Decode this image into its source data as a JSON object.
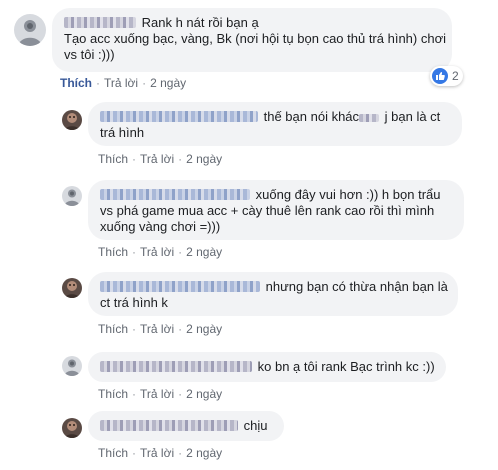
{
  "comments": [
    {
      "id": "c1",
      "text": "Rank h nát rồi bạn ạ\nTạo acc xuống bạc, vàng, Bk (nơi hội tụ bọn cao thủ trá hình) chơi vs tôi :)))",
      "text_line1": "Rank h nát rồi bạn ạ",
      "text_line2": "Tạo acc xuống bạc, vàng, Bk (nơi hội tụ bọn cao thủ trá hình) chơi",
      "text_line3": "vs tôi :)))",
      "like_label": "Thích",
      "reply_label": "Trả lời",
      "time": "2 ngày",
      "reaction_count": "2"
    },
    {
      "id": "r1",
      "text_line1": "thế bạn nói khác",
      "text_line1b": " j bạn là ct",
      "text_line2": "trá hình",
      "like_label": "Thích",
      "reply_label": "Trả lời",
      "time": "2 ngày"
    },
    {
      "id": "r2",
      "text_line1": "xuống đây vui hơn :)) h bọn trẩu",
      "text_line2": "vs phá game mua acc + cày thuê lên rank cao rồi thì mình",
      "text_line3": "xuống vàng chơi =)))",
      "like_label": "Thích",
      "reply_label": "Trả lời",
      "time": "2 ngày"
    },
    {
      "id": "r3",
      "text_line1": "nhưng bạn có thừa nhận bạn là",
      "text_line2": "ct trá hình k",
      "like_label": "Thích",
      "reply_label": "Trả lời",
      "time": "2 ngày"
    },
    {
      "id": "r4",
      "text_line1": "ko bn ạ tôi rank Bạc trình kc :))",
      "like_label": "Thích",
      "reply_label": "Trả lời",
      "time": "2 ngày"
    },
    {
      "id": "r5",
      "text_line1": "chịu",
      "like_label": "Thích",
      "reply_label": "Trả lời",
      "time": "2 ngày"
    }
  ],
  "separator": "·",
  "icons": {
    "like": "like-icon",
    "avatar_default": "default-avatar-icon"
  },
  "colors": {
    "bubble": "#f2f3f5",
    "link": "#385898",
    "meta": "#616770",
    "like_badge": "#3578e5"
  }
}
